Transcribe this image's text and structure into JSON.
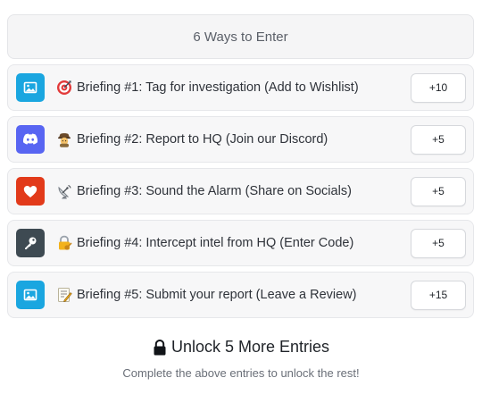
{
  "header": {
    "title": "6 Ways to Enter"
  },
  "entries": [
    {
      "icon": "image-icon",
      "badge_color": "#1aa6e0",
      "emoji": "target-emoji",
      "label": "Briefing #1: Tag for investigation (Add to Wishlist)",
      "points": "+10"
    },
    {
      "icon": "discord-icon",
      "badge_color": "#5865f2",
      "emoji": "detective-emoji",
      "label": "Briefing #2: Report to HQ (Join our Discord)",
      "points": "+5"
    },
    {
      "icon": "heart-icon",
      "badge_color": "#e23a1a",
      "emoji": "satellite-antenna-emoji",
      "label": "Briefing #3: Sound the Alarm (Share on Socials)",
      "points": "+5"
    },
    {
      "icon": "key-icon",
      "badge_color": "#3e4a52",
      "emoji": "locked-with-key-emoji",
      "label": "Briefing #4: Intercept intel from HQ (Enter Code)",
      "points": "+5"
    },
    {
      "icon": "image-icon",
      "badge_color": "#1aa6e0",
      "emoji": "memo-emoji",
      "label": "Briefing #5: Submit your report (Leave a Review)",
      "points": "+15"
    }
  ],
  "unlock": {
    "title": "Unlock 5 More Entries",
    "subtext": "Complete the above entries to unlock the rest!"
  }
}
